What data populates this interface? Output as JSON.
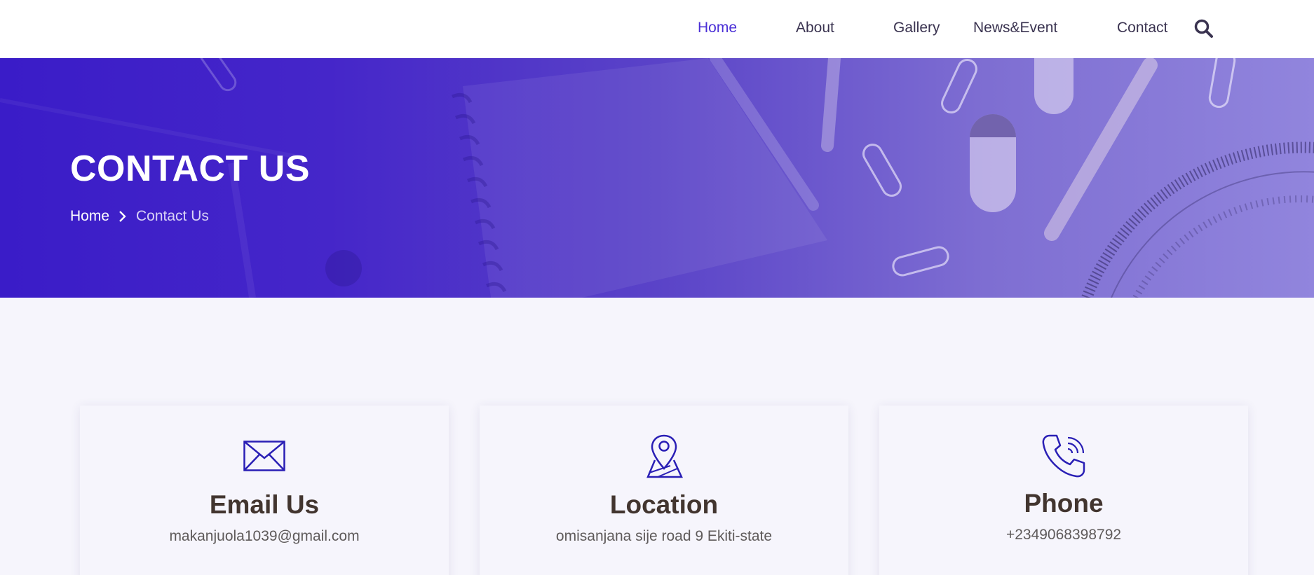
{
  "nav": {
    "items": [
      {
        "label": "Home",
        "active": true
      },
      {
        "label": "About",
        "active": false
      },
      {
        "label": "Gallery",
        "active": false
      },
      {
        "label": "News&Event",
        "active": false
      },
      {
        "label": "Contact",
        "active": false
      }
    ],
    "search_icon": "search-icon"
  },
  "hero": {
    "title": "CONTACT US",
    "breadcrumb": {
      "home": "Home",
      "separator_icon": "chevron-right-icon",
      "current": "Contact Us"
    }
  },
  "cards": [
    {
      "icon": "envelope-icon",
      "title": "Email Us",
      "text": "makanjuola1039@gmail.com"
    },
    {
      "icon": "map-pin-icon",
      "title": "Location",
      "text": "omisanjana sije road 9 Ekiti-state"
    },
    {
      "icon": "phone-icon",
      "title": "Phone",
      "text": "+2349068398792"
    }
  ],
  "colors": {
    "accent": "#4a2fd6",
    "hero_gradient_start": "#3a1cc8",
    "hero_gradient_end": "#9185dd",
    "heading_text": "#42352f",
    "page_background": "#f6f5fc",
    "icon_stroke": "#2a1fb5"
  }
}
